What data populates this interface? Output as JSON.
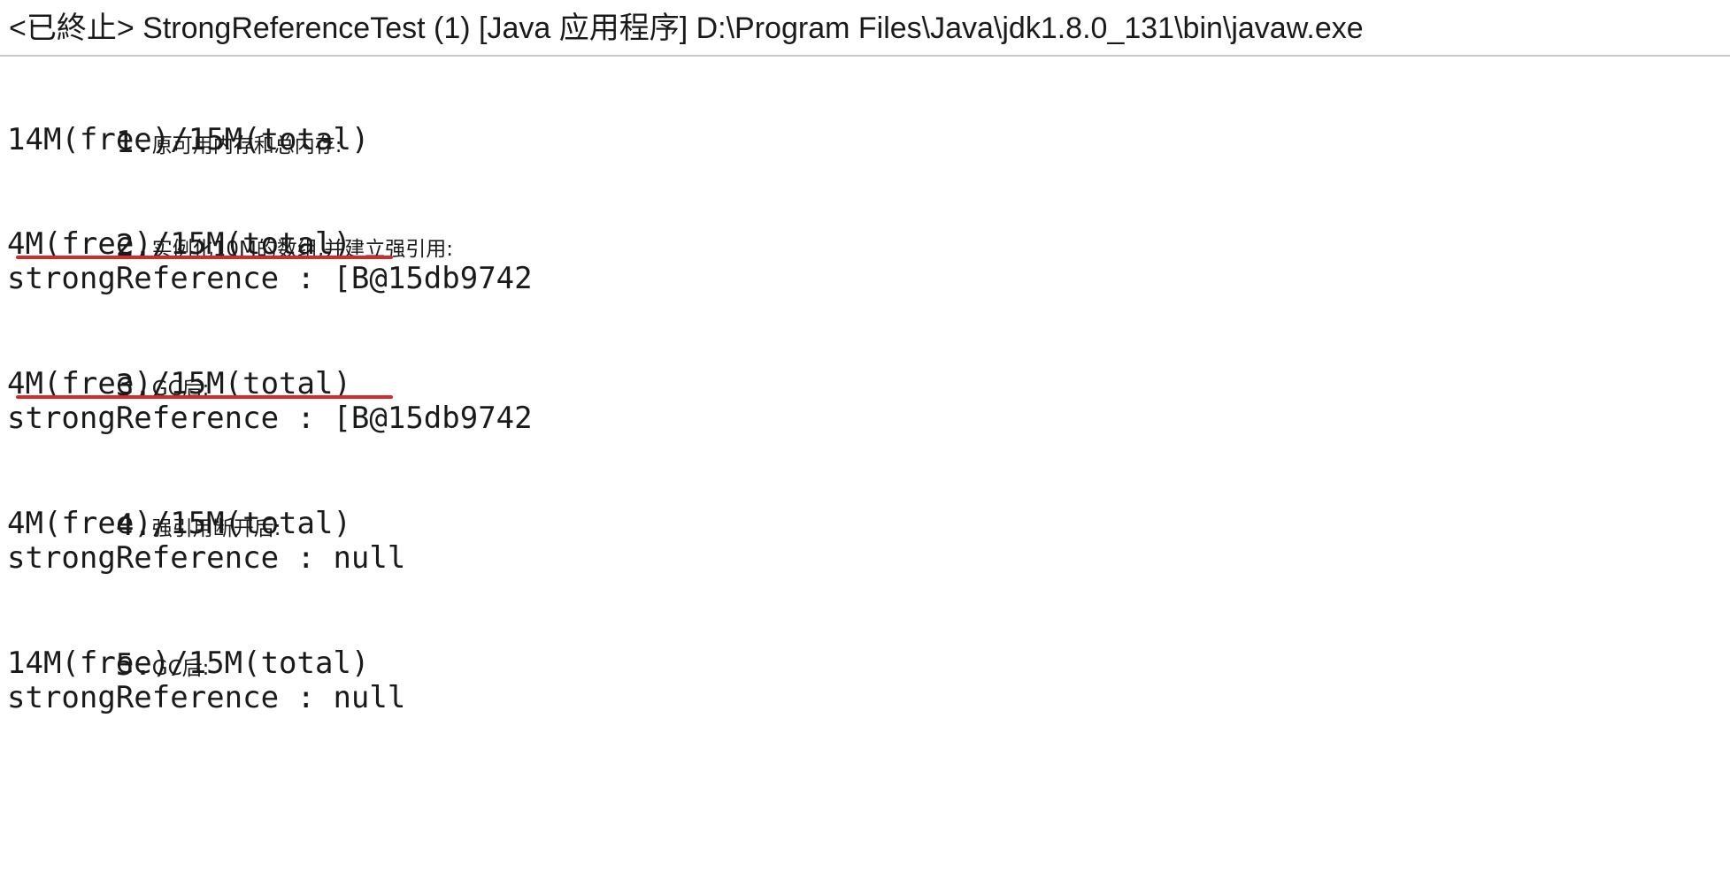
{
  "title_bar": {
    "text": "<已終止> StrongReferenceTest (1) [Java 应用程序] D:\\Program Files\\Java\\jdk1.8.0_131\\bin\\javaw.exe"
  },
  "console": {
    "step1": {
      "num": "1.",
      "label": "原可用内存和总内存:",
      "memory": "14M(free)/15M(total)"
    },
    "step2": {
      "num": "2.",
      "label": "实例化10M的数组,并建立强引用:",
      "memory": "4M(free)/15M(total)",
      "reference": "strongReference : [B@15db9742"
    },
    "step3": {
      "num": "3.",
      "label": "GC后:",
      "memory": "4M(free)/15M(total)",
      "reference": "strongReference : [B@15db9742"
    },
    "step4": {
      "num": "4.",
      "label": "强引用断开后:",
      "memory": "4M(free)/15M(total)",
      "reference": "strongReference : null"
    },
    "step5": {
      "num": "5.",
      "label": "GC后:",
      "memory": "14M(free)/15M(total)",
      "reference": "strongReference : null"
    }
  },
  "colors": {
    "annotation_underline": "#d42a2a",
    "text": "#1a1a1a",
    "separator": "#c8c8c8"
  }
}
